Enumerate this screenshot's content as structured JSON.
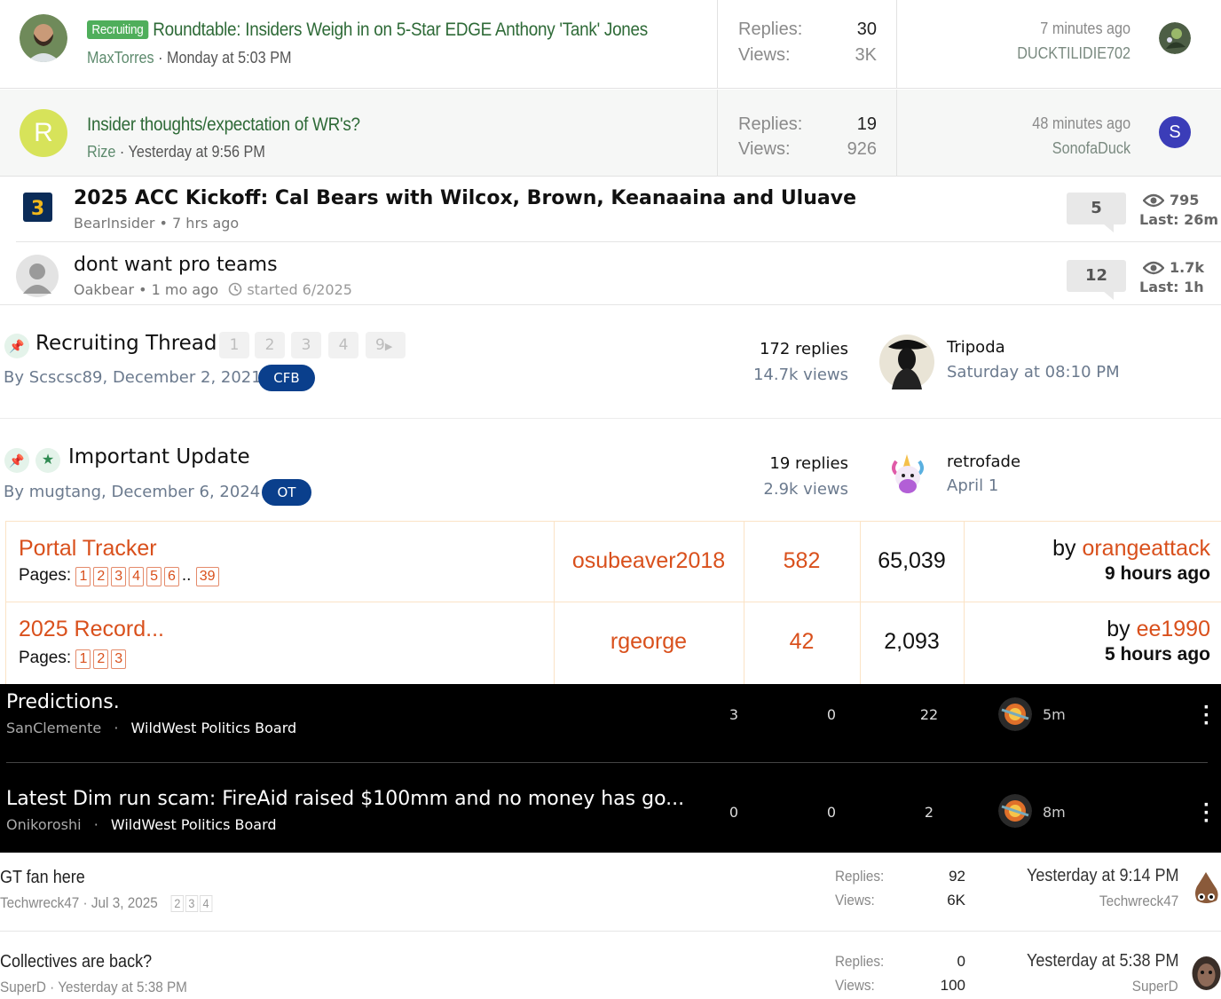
{
  "block1": {
    "rows": [
      {
        "prefix": "Recruiting",
        "title": "Roundtable: Insiders Weigh in on 5-Star EDGE Anthony 'Tank' Jones",
        "author": "MaxTorres",
        "sep": " · ",
        "date": "Monday at 5:03 PM",
        "replies_label": "Replies:",
        "replies": "30",
        "views_label": "Views:",
        "views": "3K",
        "last_time": "7 minutes ago",
        "last_user": "DUCKTILIDIE702"
      },
      {
        "avatar_letter": "R",
        "avatar_color": "#d7e35a",
        "title": "Insider thoughts/expectation of WR's?",
        "author": "Rize",
        "sep": " · ",
        "date": "Yesterday at 9:56 PM",
        "replies_label": "Replies:",
        "replies": "19",
        "views_label": "Views:",
        "views": "926",
        "last_time": "48 minutes ago",
        "last_user": "SonofaDuck",
        "last_avatar_letter": "S",
        "last_avatar_color": "#3b3db8"
      }
    ],
    "accent": "#2e6a37"
  },
  "block2": {
    "rows": [
      {
        "title": "2025 ACC Kickoff: Cal Bears with Wilcox, Brown, Keanaaina and Uluave",
        "meta": "BearInsider • 7 hrs ago",
        "count": "5",
        "views": "795",
        "last": "Last: 26m"
      },
      {
        "title": "dont want pro teams",
        "meta": "Oakbear • 1 mo ago",
        "started": "started 6/2025",
        "count": "12",
        "views": "1.7k",
        "last": "Last: 1h"
      }
    ]
  },
  "block3": {
    "rows": [
      {
        "title": "Recruiting Thread",
        "pages": [
          "1",
          "2",
          "3",
          "4",
          "9"
        ],
        "meta": "By Scscsc89, December 2, 2021",
        "tag": "CFB",
        "replies": "172 replies",
        "views": "14.7k views",
        "last_user": "Tripoda",
        "last_date": "Saturday at 08:10 PM"
      },
      {
        "title": "Important Update",
        "meta": "By mugtang, December 6, 2024",
        "tag": "OT",
        "replies": "19 replies",
        "views": "2.9k views",
        "last_user": "retrofade",
        "last_date": "April 1"
      }
    ]
  },
  "block4": {
    "pages_label": "Pages:",
    "by_label": "by ",
    "rows": [
      {
        "title": "Portal Tracker",
        "pages": [
          "1",
          "2",
          "3",
          "4",
          "5",
          "6"
        ],
        "ellipsis": "..",
        "last_page": "39",
        "starter": "osubeaver2018",
        "replies": "582",
        "views": "65,039",
        "last_user": "orangeattack",
        "ago": "9 hours ago"
      },
      {
        "title": "2025 Record...",
        "pages": [
          "1",
          "2",
          "3"
        ],
        "starter": "rgeorge",
        "replies": "42",
        "views": "2,093",
        "last_user": "ee1990",
        "ago": "5 hours ago"
      }
    ],
    "accent": "#d9501c"
  },
  "block5": {
    "rows": [
      {
        "title": "Predictions.",
        "author": "SanClemente",
        "dot": "·",
        "board": "WildWest Politics Board",
        "n1": "3",
        "n2": "0",
        "n3": "22",
        "time": "5m"
      },
      {
        "title": "Latest Dim run scam: FireAid raised $100mm and no money has go...",
        "author": "Onikoroshi",
        "dot": "·",
        "board": "WildWest Politics Board",
        "n1": "0",
        "n2": "0",
        "n3": "2",
        "time": "8m"
      }
    ]
  },
  "block6": {
    "rows": [
      {
        "title": "GT fan here",
        "meta": "Techwreck47 · Jul 3, 2025",
        "pages": [
          "2",
          "3",
          "4"
        ],
        "replies_label": "Replies:",
        "replies": "92",
        "views_label": "Views:",
        "views": "6K",
        "last_time": "Yesterday at 9:14 PM",
        "last_user": "Techwreck47"
      },
      {
        "title": "Collectives are back?",
        "meta": "SuperD · Yesterday at 5:38 PM",
        "replies_label": "Replies:",
        "replies": "0",
        "views_label": "Views:",
        "views": "100",
        "last_time": "Yesterday at 5:38 PM",
        "last_user": "SuperD"
      }
    ]
  }
}
